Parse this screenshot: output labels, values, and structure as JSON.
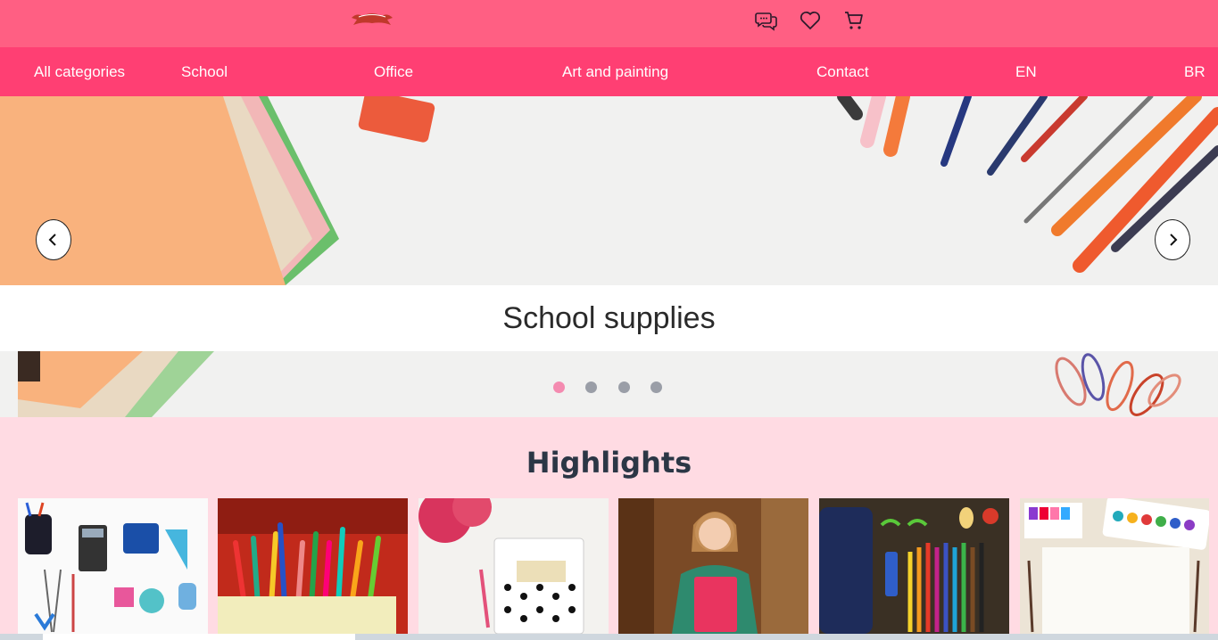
{
  "header": {
    "logo_alt": "logo ribbon",
    "icons": [
      "chat-icon",
      "heart-icon",
      "cart-icon"
    ]
  },
  "nav": {
    "items": [
      "All categories",
      "School",
      "Office",
      "Art and painting",
      "Contact",
      "EN",
      "BR"
    ]
  },
  "hero": {
    "caption": "School supplies",
    "slides_count": 4,
    "active_slide": 1
  },
  "highlights": {
    "title": "Highlights",
    "cards": [
      "office-tools-image",
      "pencil-holder-image",
      "notebook-image",
      "student-image",
      "pencil-case-image",
      "watercolor-image"
    ]
  },
  "colors": {
    "topbar": "#ff5f83",
    "nav": "#ff3f73",
    "section_bg": "#ffdbe3",
    "dot_active": "#f48bb0",
    "dot_inactive": "#9a9ea7"
  }
}
